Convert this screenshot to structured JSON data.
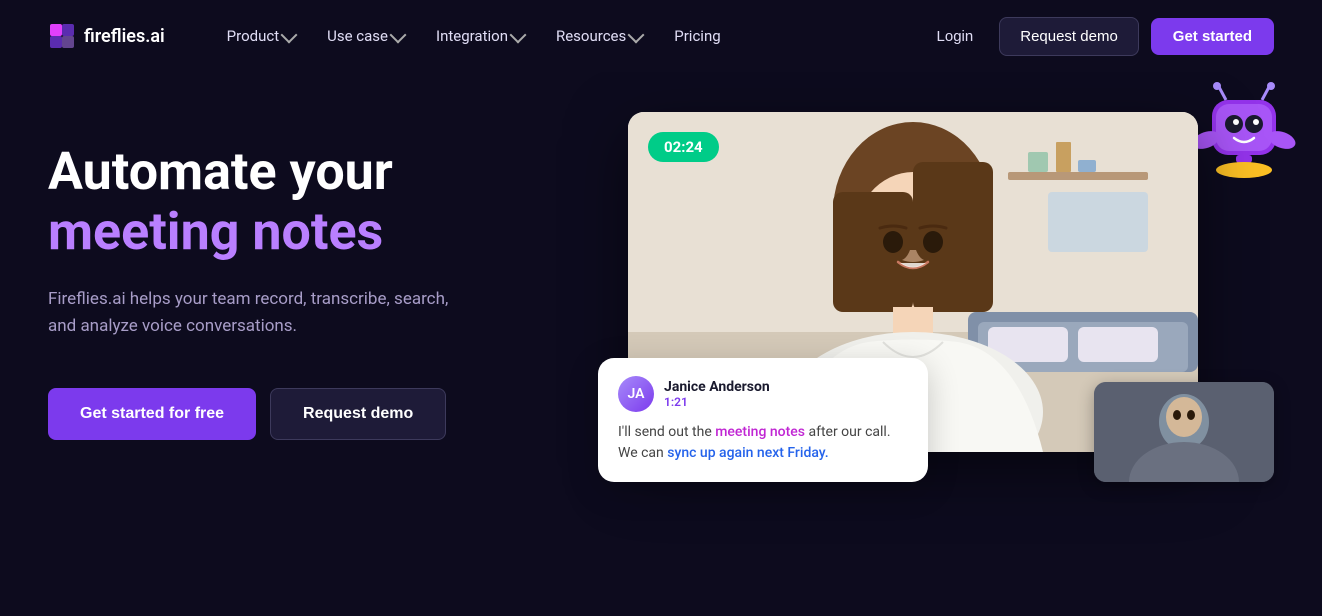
{
  "brand": {
    "name": "fireflies.ai",
    "logo_alt": "Fireflies AI logo"
  },
  "nav": {
    "product_label": "Product",
    "use_case_label": "Use case",
    "integration_label": "Integration",
    "resources_label": "Resources",
    "pricing_label": "Pricing",
    "login_label": "Login",
    "request_demo_label": "Request demo",
    "get_started_label": "Get started"
  },
  "hero": {
    "title_line1": "Automate your",
    "title_line2": "meeting notes",
    "description": "Fireflies.ai helps your team record, transcribe, search, and analyze voice conversations.",
    "cta_primary": "Get started for free",
    "cta_secondary": "Request demo"
  },
  "video_card": {
    "timer": "02:24"
  },
  "chat_popup": {
    "user_name": "Janice Anderson",
    "timestamp": "1:21",
    "message_before": "I'll send out the ",
    "link1_text": "meeting notes",
    "message_middle": " after our call. We can ",
    "link2_text": "sync up again next Friday.",
    "message_after": ""
  },
  "colors": {
    "brand_purple": "#7c3aed",
    "highlight_purple": "#b97fff",
    "bg_dark": "#0d0b1e",
    "timer_green": "#00cc88"
  }
}
